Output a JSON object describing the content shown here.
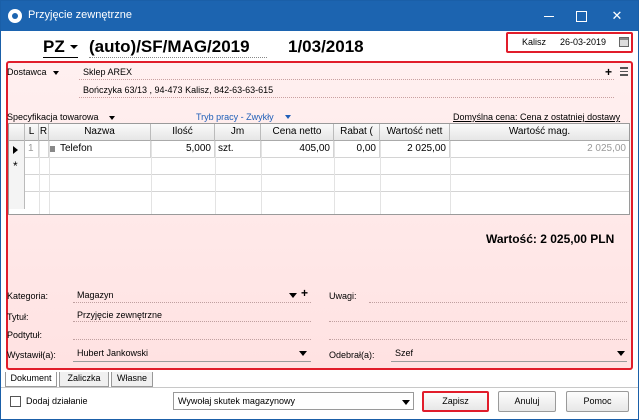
{
  "window": {
    "title": "Przyjęcie zewnętrzne"
  },
  "header": {
    "doc_type": "PZ",
    "doc_number": "(auto)/SF/MAG/2019",
    "doc_date": "1/03/2018",
    "place": "Kalisz",
    "issue_date": "26-03-2019"
  },
  "supplier": {
    "label": "Dostawca",
    "name": "Sklep AREX",
    "address": "Bończyka  63/13 , 94-473 Kalisz, 842-63-63-615"
  },
  "specification": {
    "label": "Specyfikacja towarowa",
    "work_mode": "Tryb pracy - Zwykły",
    "default_price": "Domyślna cena: Cena z ostatniej dostawy"
  },
  "grid": {
    "columns": [
      "L",
      "R",
      "Nazwa",
      "Ilość",
      "Jm",
      "Cena netto",
      "Rabat (",
      "Wartość nett",
      "Wartość mag."
    ],
    "rows": [
      {
        "lp": "1",
        "name": "Telefon",
        "qty": "5,000",
        "unit": "szt.",
        "price": "405,00",
        "discount": "0,00",
        "net_value": "2 025,00",
        "stock_value": "2 025,00"
      }
    ]
  },
  "total": "Wartość: 2 025,00 PLN",
  "fields": {
    "category_label": "Kategoria:",
    "category_value": "Magazyn",
    "title_label": "Tytuł:",
    "title_value": "Przyjęcie zewnętrzne",
    "subtitle_label": "Podtytuł:",
    "issued_by_label": "Wystawił(a):",
    "issued_by_value": "Hubert Jankowski",
    "notes_label": "Uwagi:",
    "received_by_label": "Odebrał(a):",
    "received_by_value": "Szef"
  },
  "tabs": [
    "Dokument",
    "Zaliczka",
    "Własne"
  ],
  "footer": {
    "add_action_label": "Dodaj działanie",
    "warehouse_effect": "Wywołaj skutek magazynowy",
    "save_label": "Zapisz",
    "cancel_label": "Anuluj",
    "help_label": "Pomoc"
  },
  "colors": {
    "titlebar": "#1c64b0",
    "highlight": "#e11d2b",
    "link": "#1f5fb8"
  }
}
